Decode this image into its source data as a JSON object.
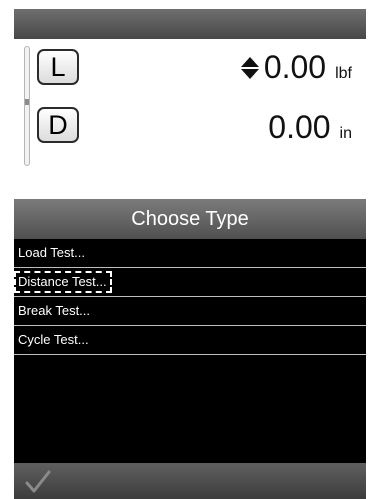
{
  "readout": {
    "load": {
      "key_label": "L",
      "value": "0.00",
      "unit": "lbf"
    },
    "distance": {
      "key_label": "D",
      "value": "0.00",
      "unit": "in"
    }
  },
  "menu": {
    "title": "Choose Type",
    "items": [
      {
        "label": "Load Test..."
      },
      {
        "label": "Distance Test..."
      },
      {
        "label": "Break Test..."
      },
      {
        "label": "Cycle Test..."
      }
    ],
    "focused_item": "Distance Test..."
  },
  "icons": {
    "direction": "up-down-arrow-icon",
    "confirm": "checkmark-icon"
  },
  "colors": {
    "bar": "#5a5a5a",
    "list_background": "#000000",
    "readout_background": "#ffffff"
  }
}
